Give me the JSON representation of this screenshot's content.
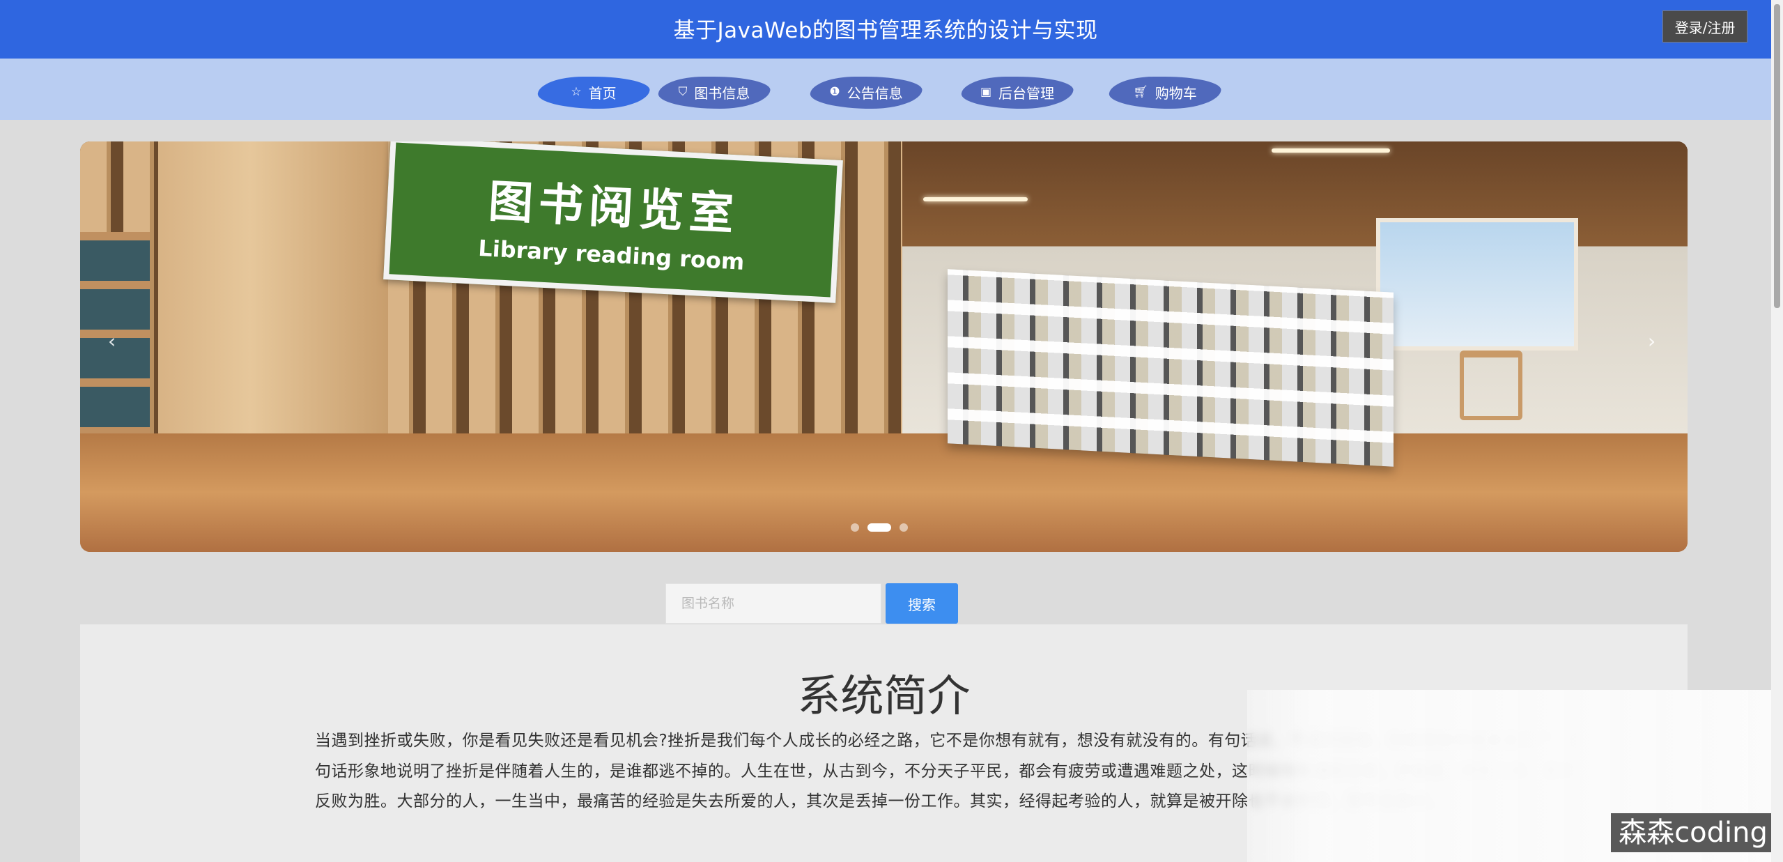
{
  "header": {
    "title": "基于JavaWeb的图书管理系统的设计与实现",
    "login_label": "登录/注册",
    "background_color": "#2f66e0"
  },
  "nav": {
    "items": [
      {
        "label": "首页",
        "icon": "star-icon"
      },
      {
        "label": "图书信息",
        "icon": "bag-icon"
      },
      {
        "label": "公告信息",
        "icon": "info-icon"
      },
      {
        "label": "后台管理",
        "icon": "building-icon"
      },
      {
        "label": "购物车",
        "icon": "cart-icon"
      }
    ],
    "active_index": 0
  },
  "carousel": {
    "sign_cn": "图书阅览室",
    "sign_en": "Library reading room",
    "prev_arrow": "‹",
    "next_arrow": "›",
    "slide_count": 3,
    "active_slide": 1
  },
  "search": {
    "placeholder": "图书名称",
    "button_label": "搜索"
  },
  "intro": {
    "title": "系统简介",
    "text": "当遇到挫折或失败，你是看见失败还是看见机会?挫折是我们每个人成长的必经之路，它不是你想有就有，想没有就没有的。有句话说，不遇到困难，你就得是神或者是死尸。这句话形象地说明了挫折是伴随着人生的，是谁都逃不掉的。人生在世，从古到今，不分天子平民，都会有疲劳或遭遇难题之处，这时候唯有通权达变，才能使人转危为安，甚至反败为胜。大部分的人，一生当中，最痛苦的经验是失去所爱的人，其次是丢掉一份工作。其实，经得起考验的人，就算是被开除也不会惊慌，要学会面对。"
  },
  "watermark": "森森coding"
}
